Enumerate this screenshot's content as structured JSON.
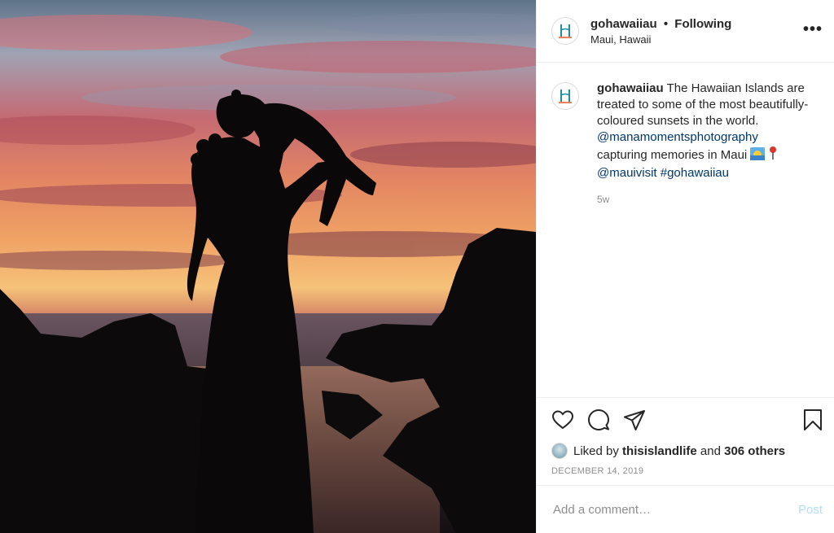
{
  "header": {
    "username": "gohawaiiau",
    "separator": "•",
    "follow_status": "Following",
    "location": "Maui, Hawaii",
    "more_label": "•••"
  },
  "caption": {
    "username": "gohawaiiau",
    "text_part1": "The Hawaiian Islands are treated to some of the most beautifully-coloured sunsets in the world.",
    "mention_photographer": "@manamomentsphotography",
    "text_part2": "capturing memories in Maui",
    "emoji_sunset": "sunset-emoji",
    "emoji_pin": "pin-emoji",
    "mention_visit": "@mauivisit",
    "hashtag": "#gohawaiiau",
    "time_ago": "5w"
  },
  "actions": {
    "like_icon": "heart-icon",
    "comment_icon": "comment-icon",
    "share_icon": "share-icon",
    "save_icon": "bookmark-icon"
  },
  "likes": {
    "prefix": "Liked by",
    "liker": "thisislandlife",
    "conjunction": "and",
    "others": "306 others"
  },
  "date": "DECEMBER 14, 2019",
  "comment_input": {
    "placeholder": "Add a comment…",
    "post_label": "Post"
  },
  "colors": {
    "link": "#00376b",
    "muted": "#8e8e8e",
    "post_disabled": "#b2dffc",
    "logo_teal": "#1f8ea0",
    "logo_orange": "#e8632a"
  }
}
